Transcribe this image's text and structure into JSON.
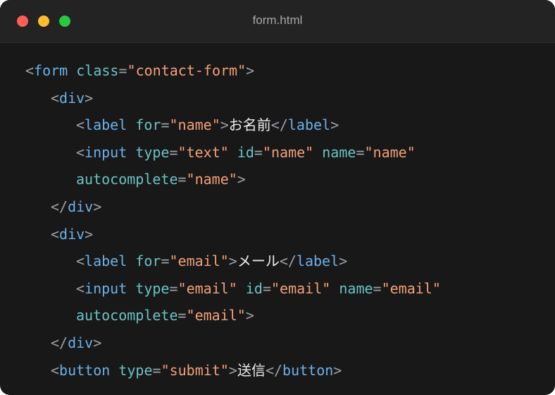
{
  "window": {
    "title": "form.html",
    "traffic_lights": [
      {
        "name": "close",
        "color": "#ff5f57"
      },
      {
        "name": "minimize",
        "color": "#febc2e"
      },
      {
        "name": "zoom",
        "color": "#28c840"
      }
    ]
  },
  "code": {
    "colors": {
      "background": "#181818",
      "punctuation": "#9aa0a6",
      "tag": "#6cb0e8",
      "attribute": "#6bc2c5",
      "string": "#f3a07a",
      "text": "#ededed"
    },
    "lines": [
      {
        "indent": 0,
        "tokens": [
          [
            "punc",
            "<"
          ],
          [
            "tag",
            "form"
          ],
          [
            "text",
            " "
          ],
          [
            "attr",
            "class"
          ],
          [
            "punc",
            "="
          ],
          [
            "str",
            "\"contact-form\""
          ],
          [
            "punc",
            ">"
          ]
        ]
      },
      {
        "indent": 1,
        "tokens": [
          [
            "punc",
            "<"
          ],
          [
            "tag",
            "div"
          ],
          [
            "punc",
            ">"
          ]
        ]
      },
      {
        "indent": 2,
        "tokens": [
          [
            "punc",
            "<"
          ],
          [
            "tag",
            "label"
          ],
          [
            "text",
            " "
          ],
          [
            "attr",
            "for"
          ],
          [
            "punc",
            "="
          ],
          [
            "str",
            "\"name\""
          ],
          [
            "punc",
            ">"
          ],
          [
            "text",
            "お名前"
          ],
          [
            "punc",
            "</"
          ],
          [
            "tag",
            "label"
          ],
          [
            "punc",
            ">"
          ]
        ]
      },
      {
        "indent": 2,
        "tokens": [
          [
            "punc",
            "<"
          ],
          [
            "tag",
            "input"
          ],
          [
            "text",
            " "
          ],
          [
            "attr",
            "type"
          ],
          [
            "punc",
            "="
          ],
          [
            "str",
            "\"text\""
          ],
          [
            "text",
            " "
          ],
          [
            "attr",
            "id"
          ],
          [
            "punc",
            "="
          ],
          [
            "str",
            "\"name\""
          ],
          [
            "text",
            " "
          ],
          [
            "attr",
            "name"
          ],
          [
            "punc",
            "="
          ],
          [
            "str",
            "\"name\""
          ]
        ]
      },
      {
        "indent": 2,
        "tokens": [
          [
            "attr",
            "autocomplete"
          ],
          [
            "punc",
            "="
          ],
          [
            "str",
            "\"name\""
          ],
          [
            "punc",
            ">"
          ]
        ]
      },
      {
        "indent": 1,
        "tokens": [
          [
            "punc",
            "</"
          ],
          [
            "tag",
            "div"
          ],
          [
            "punc",
            ">"
          ]
        ]
      },
      {
        "indent": 1,
        "tokens": [
          [
            "punc",
            "<"
          ],
          [
            "tag",
            "div"
          ],
          [
            "punc",
            ">"
          ]
        ]
      },
      {
        "indent": 2,
        "tokens": [
          [
            "punc",
            "<"
          ],
          [
            "tag",
            "label"
          ],
          [
            "text",
            " "
          ],
          [
            "attr",
            "for"
          ],
          [
            "punc",
            "="
          ],
          [
            "str",
            "\"email\""
          ],
          [
            "punc",
            ">"
          ],
          [
            "text",
            "メール"
          ],
          [
            "punc",
            "</"
          ],
          [
            "tag",
            "label"
          ],
          [
            "punc",
            ">"
          ]
        ]
      },
      {
        "indent": 2,
        "tokens": [
          [
            "punc",
            "<"
          ],
          [
            "tag",
            "input"
          ],
          [
            "text",
            " "
          ],
          [
            "attr",
            "type"
          ],
          [
            "punc",
            "="
          ],
          [
            "str",
            "\"email\""
          ],
          [
            "text",
            " "
          ],
          [
            "attr",
            "id"
          ],
          [
            "punc",
            "="
          ],
          [
            "str",
            "\"email\""
          ],
          [
            "text",
            " "
          ],
          [
            "attr",
            "name"
          ],
          [
            "punc",
            "="
          ],
          [
            "str",
            "\"email\""
          ]
        ]
      },
      {
        "indent": 2,
        "tokens": [
          [
            "attr",
            "autocomplete"
          ],
          [
            "punc",
            "="
          ],
          [
            "str",
            "\"email\""
          ],
          [
            "punc",
            ">"
          ]
        ]
      },
      {
        "indent": 1,
        "tokens": [
          [
            "punc",
            "</"
          ],
          [
            "tag",
            "div"
          ],
          [
            "punc",
            ">"
          ]
        ]
      },
      {
        "indent": 1,
        "tokens": [
          [
            "punc",
            "<"
          ],
          [
            "tag",
            "button"
          ],
          [
            "text",
            " "
          ],
          [
            "attr",
            "type"
          ],
          [
            "punc",
            "="
          ],
          [
            "str",
            "\"submit\""
          ],
          [
            "punc",
            ">"
          ],
          [
            "text",
            "送信"
          ],
          [
            "punc",
            "</"
          ],
          [
            "tag",
            "button"
          ],
          [
            "punc",
            ">"
          ]
        ]
      }
    ]
  }
}
